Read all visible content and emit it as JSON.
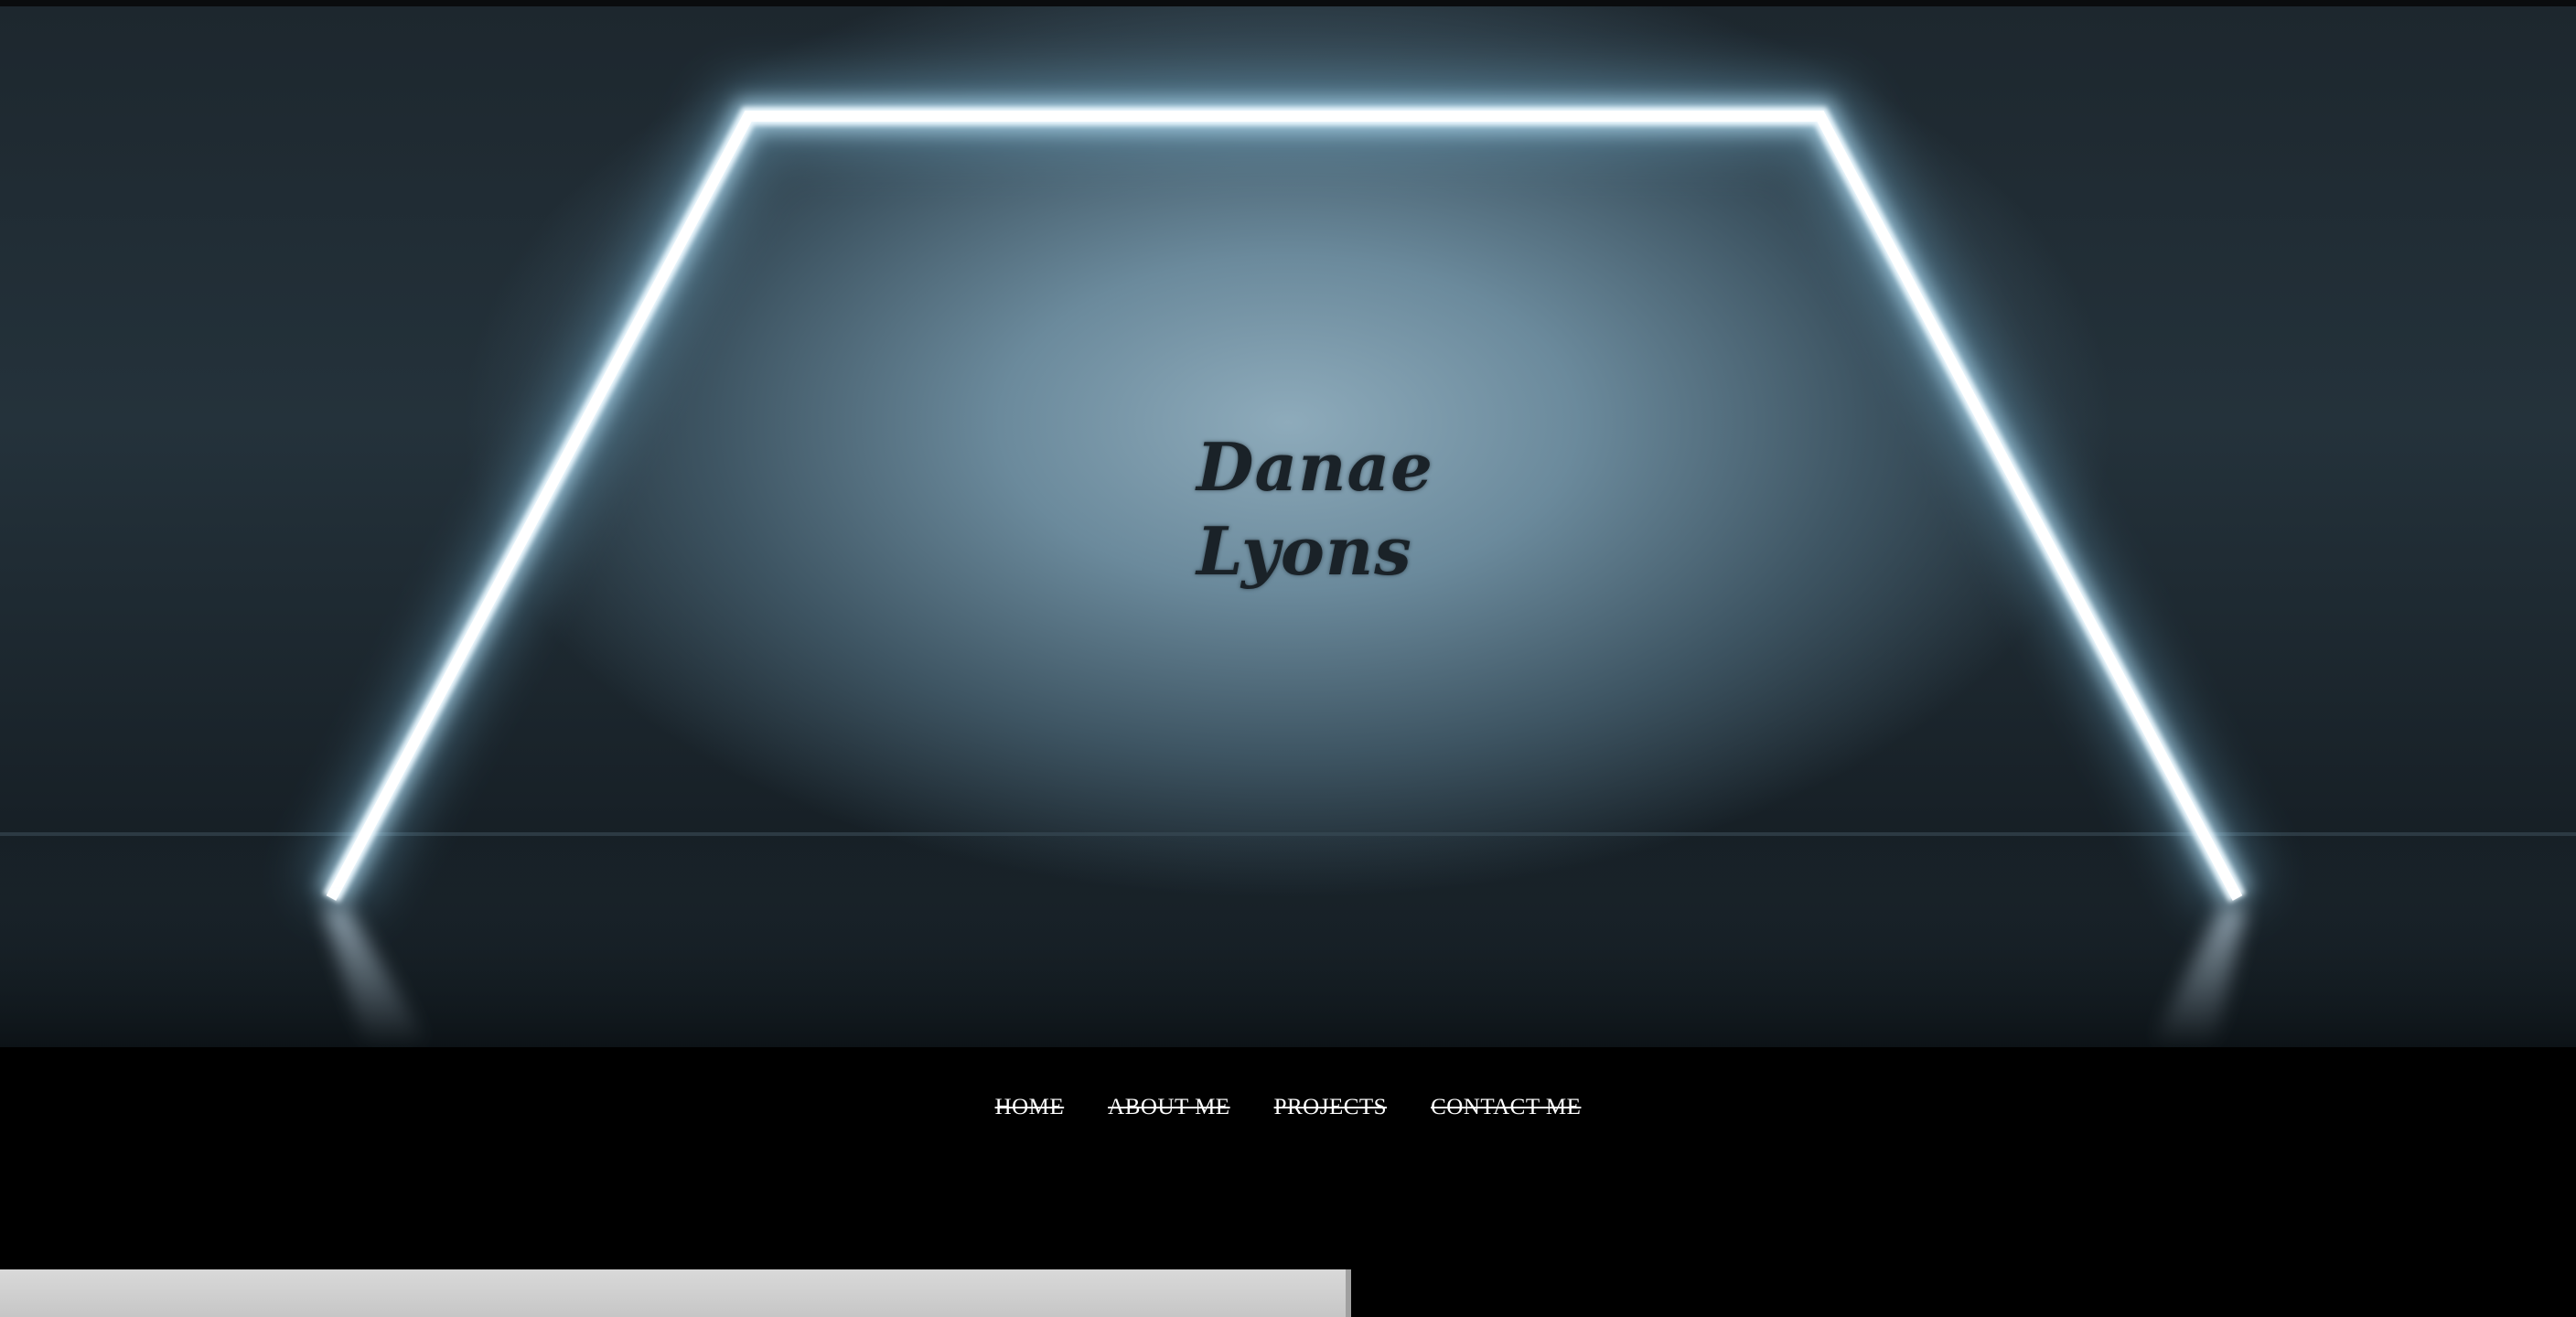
{
  "hero": {
    "logo_line1": "Danae",
    "logo_line2": "Lyons",
    "colors": {
      "neon": "#e8f6ff",
      "glow": "#9fd3ef",
      "wall": "#6b8a9c"
    }
  },
  "nav": {
    "items": [
      {
        "label": "HOME"
      },
      {
        "label": "ABOUT ME"
      },
      {
        "label": "PROJECTS"
      },
      {
        "label": "CONTACT ME"
      }
    ]
  },
  "theme": {
    "background": "#000000",
    "text": "#ffffff"
  }
}
